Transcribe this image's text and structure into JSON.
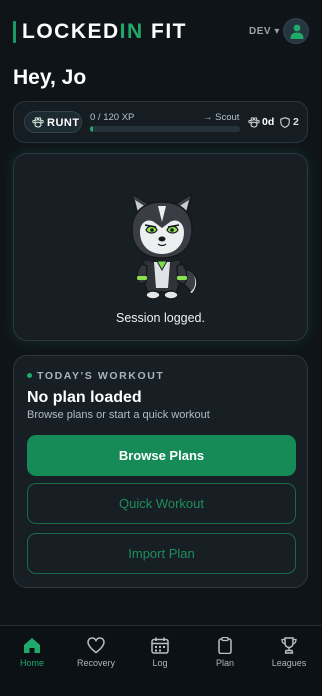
{
  "header": {
    "brand_part1": "LOCKED",
    "brand_accent": "IN",
    "brand_part2": " FIT",
    "env_label": "DEV ▾",
    "avatar_icon": "user-icon"
  },
  "greeting": "Hey, Jo",
  "progress": {
    "rank": "RUNT",
    "rank_icon": "paw-icon",
    "xp_text": "0 / 120 XP",
    "xp_fraction": 0.02,
    "next_rank": "→ Scout",
    "streak": "0d",
    "streak_icon": "paw-icon",
    "shields": "2",
    "shield_icon": "shield-icon"
  },
  "mascot": {
    "icon": "husky-mascot",
    "message": "Session logged."
  },
  "workout": {
    "section_label": "TODAY'S WORKOUT",
    "title": "No plan loaded",
    "subtitle": "Browse plans or start a quick workout",
    "browse_label": "Browse Plans",
    "quick_label": "Quick Workout",
    "import_label": "Import Plan"
  },
  "tabs": [
    {
      "label": "Home",
      "icon": "home-icon",
      "active": true
    },
    {
      "label": "Recovery",
      "icon": "heart-icon",
      "active": false
    },
    {
      "label": "Log",
      "icon": "calendar-icon",
      "active": false
    },
    {
      "label": "Plan",
      "icon": "clipboard-icon",
      "active": false
    },
    {
      "label": "Leagues",
      "icon": "trophy-icon",
      "active": false
    }
  ],
  "colors": {
    "background": "#0f1419",
    "accent": "#1faa6b",
    "primary_button": "#168a57",
    "card": "#171e24"
  }
}
